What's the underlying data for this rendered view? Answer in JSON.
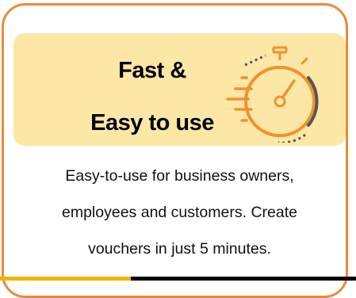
{
  "card": {
    "title_line1": "Fast &",
    "title_line2": "Easy to use",
    "description_lines": [
      "Easy-to-use for business owners,",
      "employees and customers. Create",
      "vouchers in just 5 minutes."
    ],
    "icon": "stopwatch-speed-icon"
  },
  "colors": {
    "border": "#ea8a3a",
    "header_bg": "#fde7a6",
    "icon_orange": "#f0922d",
    "icon_dark": "#555555"
  }
}
